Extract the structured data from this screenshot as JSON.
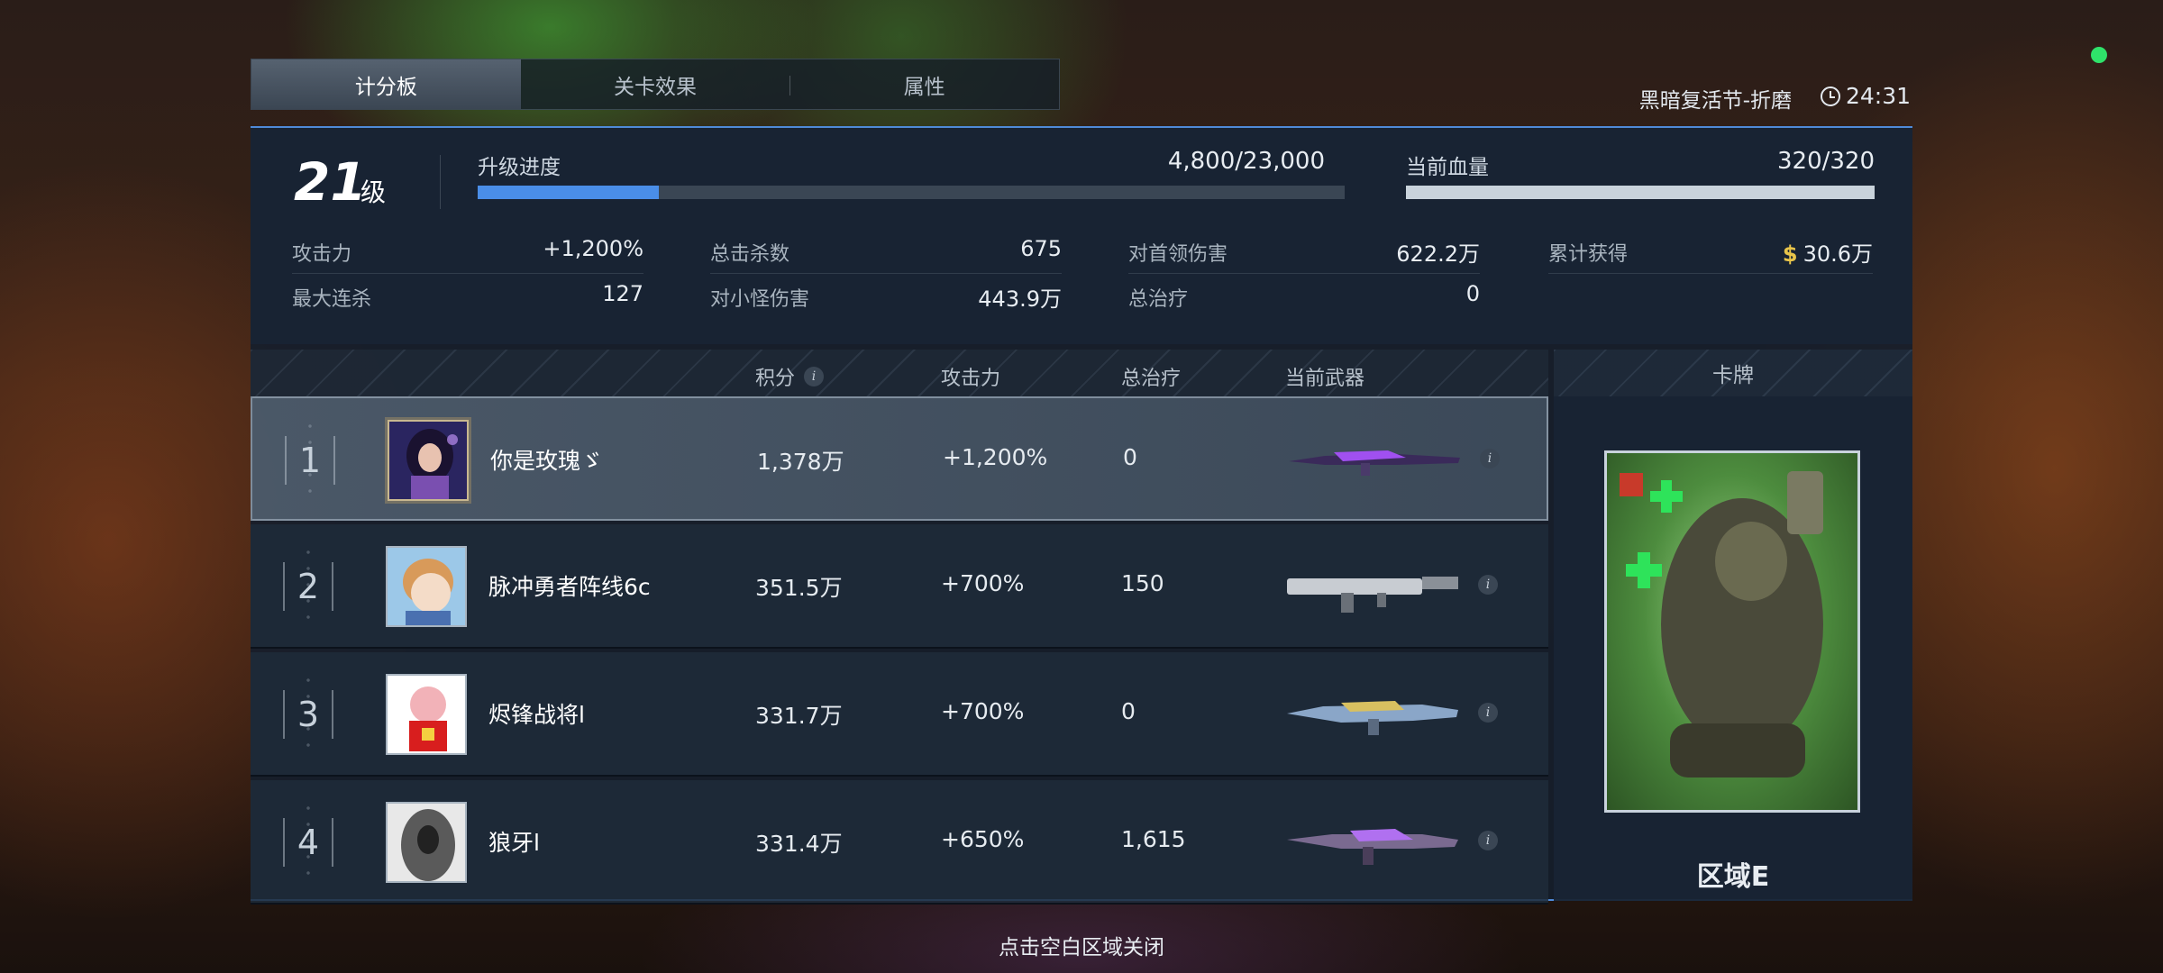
{
  "tabs": [
    {
      "label": "计分板",
      "active": true
    },
    {
      "label": "关卡效果",
      "active": false
    },
    {
      "label": "属性",
      "active": false
    }
  ],
  "level_name": "黑暗复活节-折磨",
  "timer": "24:31",
  "player": {
    "level": "21",
    "level_suffix": "级",
    "progress_label": "升级进度",
    "progress_value": "4,800/23,000",
    "progress_fraction": 0.209,
    "hp_label": "当前血量",
    "hp_value": "320/320",
    "hp_fraction": 1.0
  },
  "stats": [
    {
      "label": "攻击力",
      "value": "+1,200%"
    },
    {
      "label": "最大连杀",
      "value": "127"
    },
    {
      "label": "总击杀数",
      "value": "675"
    },
    {
      "label": "对小怪伤害",
      "value": "443.9万"
    },
    {
      "label": "对首领伤害",
      "value": "622.2万"
    },
    {
      "label": "总治疗",
      "value": "0"
    },
    {
      "label": "累计获得",
      "value": "30.6万"
    }
  ],
  "table": {
    "headers": {
      "score": "积分",
      "attack": "攻击力",
      "heal": "总治疗",
      "weapon": "当前武器"
    },
    "rows": [
      {
        "rank": "1",
        "name": "你是玫瑰ゞ",
        "score": "1,378万",
        "attack": "+1,200%",
        "heal": "0"
      },
      {
        "rank": "2",
        "name": "脉冲勇者阵线6c",
        "score": "351.5万",
        "attack": "+700%",
        "heal": "150"
      },
      {
        "rank": "3",
        "name": "烬锋战将l",
        "score": "331.7万",
        "attack": "+700%",
        "heal": "0"
      },
      {
        "rank": "4",
        "name": "狼牙l",
        "score": "331.4万",
        "attack": "+650%",
        "heal": "1,615"
      }
    ]
  },
  "card": {
    "header": "卡牌",
    "name": "区域E"
  },
  "close_hint": "点击空白区域关闭",
  "colors": {
    "accent": "#4a8ee8",
    "status": "#2fe26a",
    "currency": "#e8c44a"
  }
}
